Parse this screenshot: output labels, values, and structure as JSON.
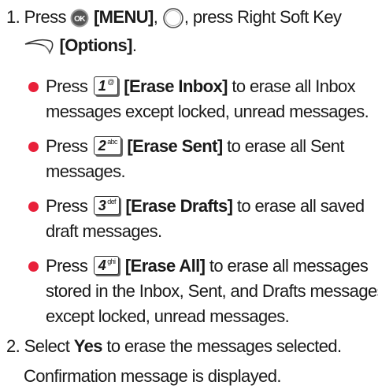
{
  "step1": {
    "number": "1.",
    "press": "Press",
    "menu_label": "[MENU]",
    "mid_text": ", press Right Soft Key",
    "options_label": "[Options]",
    "period": ".",
    "icons": [
      "ok-button-icon",
      "nav-key-icon",
      "right-soft-key-icon"
    ]
  },
  "bullets": [
    {
      "press": "Press",
      "key_digit": "1",
      "key_letters": "@",
      "label": "[Erase Inbox]",
      "line1": " to erase all Inbox",
      "line2": "messages except locked, unread messages."
    },
    {
      "press": "Press",
      "key_digit": "2",
      "key_letters": "abc",
      "label": "[Erase Sent]",
      "line1": " to erase all Sent",
      "line2": "messages."
    },
    {
      "press": "Press",
      "key_digit": "3",
      "key_letters": "def",
      "label": "[Erase Drafts]",
      "line1": " to erase all saved",
      "line2": "draft messages."
    },
    {
      "press": "Press",
      "key_digit": "4",
      "key_letters": "ghi",
      "label": "[Erase All]",
      "line1": " to erase all messages",
      "line2": "stored in the Inbox, Sent, and Drafts messages",
      "line3": "except locked, unread messages."
    }
  ],
  "step2": {
    "number": "2.",
    "select": "Select",
    "yes": "Yes",
    "rest": " to erase the messages selected."
  },
  "confirmation": "Confirmation message is displayed.",
  "colors": {
    "bullet": "#e8203a",
    "text": "#1a1a1a"
  }
}
